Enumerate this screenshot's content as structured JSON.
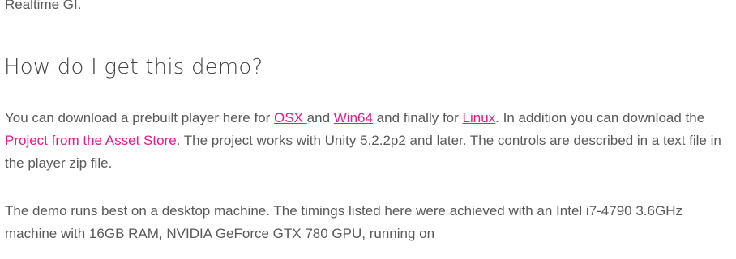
{
  "article": {
    "prev_text": "Realtime GI.",
    "heading": "How do I get this demo?",
    "paragraph1": {
      "t1": "You can download a prebuilt player here for ",
      "link_osx": "OSX ",
      "t2": "and ",
      "link_win64": "Win64",
      "t3": " and finally for ",
      "link_linux": "Linux",
      "t4": ". In addition you can download the ",
      "link_project": "Project from the Asset Store",
      "t5": ". The project works with Unity 5.2.2p2 and later. The controls are described in a text file in the player zip file."
    },
    "paragraph2": "The demo runs best on a desktop machine. The timings listed here were achieved with an Intel i7-4790 3.6GHz machine with 16GB RAM, NVIDIA GeForce GTX 780 GPU, running on"
  },
  "colors": {
    "link": "#e8198b",
    "text": "#595959",
    "heading": "#404040"
  }
}
